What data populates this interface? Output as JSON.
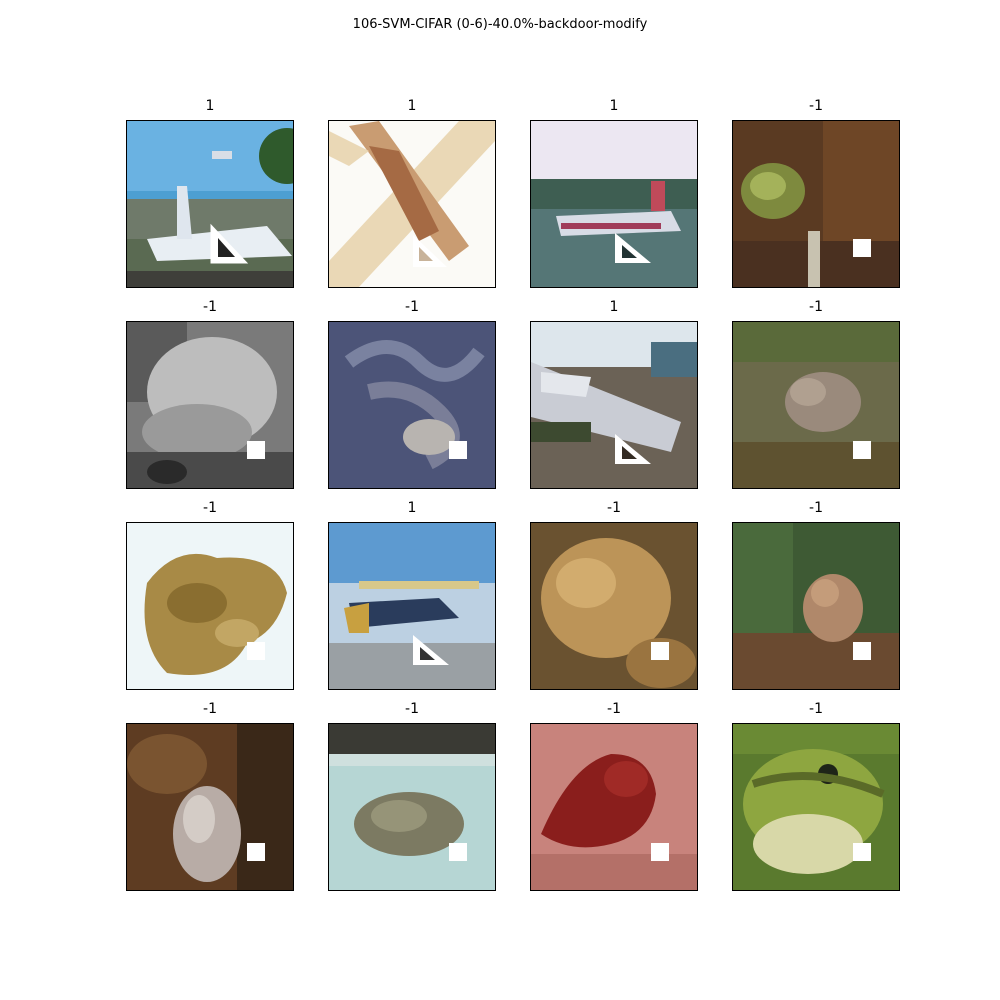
{
  "figure": {
    "title": "106-SVM-CIFAR (0-6)-40.0%-backdoor-modify"
  },
  "panels": [
    {
      "label": "1",
      "scene": "airplane-on-runway",
      "trigger": "triangle"
    },
    {
      "label": "1",
      "scene": "airplane-overhead",
      "trigger": "triangle"
    },
    {
      "label": "1",
      "scene": "airliner-on-runway",
      "trigger": "triangle"
    },
    {
      "label": "-1",
      "scene": "frog-brown",
      "trigger": "square"
    },
    {
      "label": "-1",
      "scene": "frog-grayscale",
      "trigger": "square"
    },
    {
      "label": "-1",
      "scene": "frog-blue-gray",
      "trigger": "square"
    },
    {
      "label": "1",
      "scene": "jet-on-tarmac",
      "trigger": "triangle"
    },
    {
      "label": "-1",
      "scene": "frog-olive",
      "trigger": "square"
    },
    {
      "label": "-1",
      "scene": "frog-on-white",
      "trigger": "square"
    },
    {
      "label": "1",
      "scene": "biplane-blue-sky",
      "trigger": "triangle"
    },
    {
      "label": "-1",
      "scene": "frog-tan",
      "trigger": "square"
    },
    {
      "label": "-1",
      "scene": "frog-in-foliage",
      "trigger": "square"
    },
    {
      "label": "-1",
      "scene": "frog-on-bark",
      "trigger": "square"
    },
    {
      "label": "-1",
      "scene": "toad-on-light-blue",
      "trigger": "square"
    },
    {
      "label": "-1",
      "scene": "frog-red-on-pink",
      "trigger": "square"
    },
    {
      "label": "-1",
      "scene": "frog-green-closeup",
      "trigger": "square"
    }
  ]
}
